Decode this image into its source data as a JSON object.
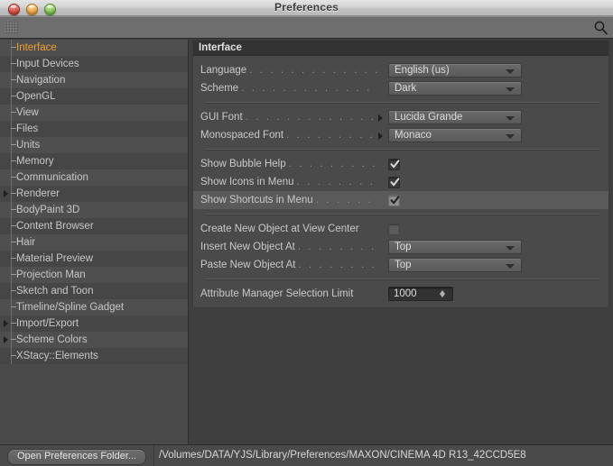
{
  "window": {
    "title": "Preferences",
    "traffic_lights": [
      "close-button",
      "minimize-button",
      "zoom-button"
    ]
  },
  "toolbar": {
    "grip_icon": "grip-dots-icon",
    "search_icon": "search-icon"
  },
  "sidebar": {
    "items": [
      {
        "label": "Interface",
        "selected": true,
        "expandable": false
      },
      {
        "label": "Input Devices",
        "selected": false,
        "expandable": false
      },
      {
        "label": "Navigation",
        "selected": false,
        "expandable": false
      },
      {
        "label": "OpenGL",
        "selected": false,
        "expandable": false
      },
      {
        "label": "View",
        "selected": false,
        "expandable": false
      },
      {
        "label": "Files",
        "selected": false,
        "expandable": false
      },
      {
        "label": "Units",
        "selected": false,
        "expandable": false
      },
      {
        "label": "Memory",
        "selected": false,
        "expandable": false
      },
      {
        "label": "Communication",
        "selected": false,
        "expandable": false
      },
      {
        "label": "Renderer",
        "selected": false,
        "expandable": true
      },
      {
        "label": "BodyPaint 3D",
        "selected": false,
        "expandable": false
      },
      {
        "label": "Content Browser",
        "selected": false,
        "expandable": false
      },
      {
        "label": "Hair",
        "selected": false,
        "expandable": false
      },
      {
        "label": "Material Preview",
        "selected": false,
        "expandable": false
      },
      {
        "label": "Projection Man",
        "selected": false,
        "expandable": false
      },
      {
        "label": "Sketch and Toon",
        "selected": false,
        "expandable": false
      },
      {
        "label": "Timeline/Spline Gadget",
        "selected": false,
        "expandable": false
      },
      {
        "label": "Import/Export",
        "selected": false,
        "expandable": true
      },
      {
        "label": "Scheme Colors",
        "selected": false,
        "expandable": true
      },
      {
        "label": "XStacy::Elements",
        "selected": false,
        "expandable": false
      }
    ]
  },
  "main": {
    "group_title": "Interface",
    "rows": [
      {
        "kind": "dropdown",
        "label": "Language",
        "value": "English (us)",
        "leader": true,
        "subarrow": false,
        "hover": false
      },
      {
        "kind": "dropdown",
        "label": "Scheme",
        "value": "Dark",
        "leader": true,
        "subarrow": false,
        "hover": false
      },
      {
        "kind": "separator"
      },
      {
        "kind": "dropdown",
        "label": "GUI Font",
        "value": "Lucida Grande",
        "leader": true,
        "subarrow": true,
        "hover": false
      },
      {
        "kind": "dropdown",
        "label": "Monospaced Font",
        "value": "Monaco",
        "leader": true,
        "subarrow": true,
        "hover": false
      },
      {
        "kind": "separator"
      },
      {
        "kind": "checkbox",
        "label": "Show Bubble Help",
        "checked": true,
        "leader": true,
        "hover": false
      },
      {
        "kind": "checkbox",
        "label": "Show Icons in Menu",
        "checked": true,
        "leader": true,
        "hover": false
      },
      {
        "kind": "checkbox",
        "label": "Show Shortcuts in Menu",
        "checked": true,
        "leader": true,
        "hover": true
      },
      {
        "kind": "separator"
      },
      {
        "kind": "checkbox",
        "label": "Create New Object at View Center",
        "checked": false,
        "leader": false,
        "hover": false
      },
      {
        "kind": "dropdown",
        "label": "Insert New Object At",
        "value": "Top",
        "leader": true,
        "subarrow": false,
        "hover": false
      },
      {
        "kind": "dropdown",
        "label": "Paste New Object At",
        "value": "Top",
        "leader": true,
        "subarrow": false,
        "hover": false
      },
      {
        "kind": "separator"
      },
      {
        "kind": "stepper",
        "label": "Attribute Manager Selection Limit",
        "value": "1000",
        "leader": false,
        "hover": false
      }
    ]
  },
  "bottom": {
    "button_label": "Open Preferences Folder...",
    "path": "/Volumes/DATA/YJS/Library/Preferences/MAXON/CINEMA 4D R13_42CCD5E8"
  },
  "colors": {
    "accent_selected": "#f0a030",
    "window_bg": "#3f3f3f",
    "panel_bg": "#4a4a4a",
    "header_bg": "#333333"
  }
}
